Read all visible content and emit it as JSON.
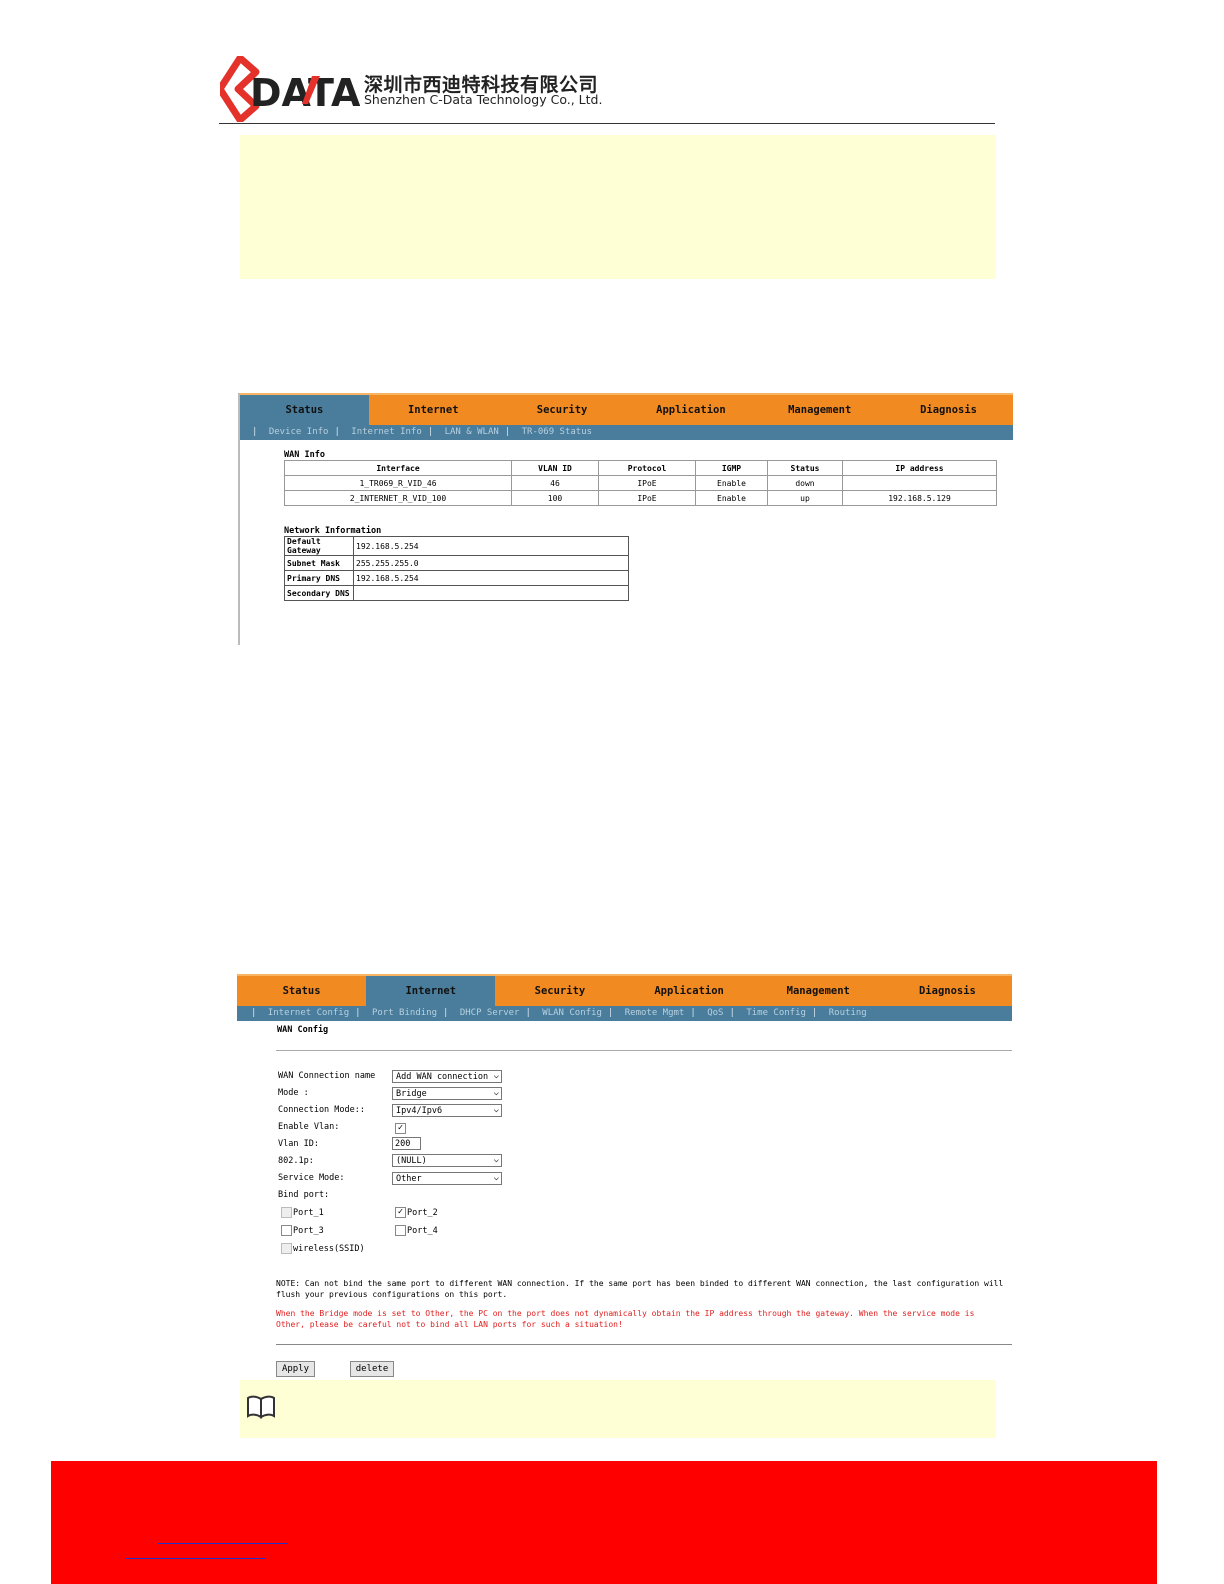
{
  "header": {
    "company_cn": "深圳市西迪特科技有限公司",
    "company_en": "Shenzhen C-Data Technology Co., Ltd.",
    "logo_text": "DATA",
    "logo_color": "#e4322b"
  },
  "screen1": {
    "tabs": [
      "Status",
      "Internet",
      "Security",
      "Application",
      "Management",
      "Diagnosis"
    ],
    "active_tab": "Status",
    "subnav": [
      "Device Info",
      "Internet Info",
      "LAN & WLAN",
      "TR-069 Status"
    ],
    "wan_title": "WAN Info",
    "wan_headers": [
      "Interface",
      "VLAN ID",
      "Protocol",
      "IGMP",
      "Status",
      "IP address"
    ],
    "wan_rows": [
      [
        "1_TR069_R_VID_46",
        "46",
        "IPoE",
        "Enable",
        "down",
        ""
      ],
      [
        "2_INTERNET_R_VID_100",
        "100",
        "IPoE",
        "Enable",
        "up",
        "192.168.5.129"
      ]
    ],
    "net_title": "Network Information",
    "net_rows": [
      [
        "Default Gateway",
        "192.168.5.254"
      ],
      [
        "Subnet Mask",
        "255.255.255.0"
      ],
      [
        "Primary DNS",
        "192.168.5.254"
      ],
      [
        "Secondary DNS",
        ""
      ]
    ]
  },
  "screen2": {
    "tabs": [
      "Status",
      "Internet",
      "Security",
      "Application",
      "Management",
      "Diagnosis"
    ],
    "active_tab": "Internet",
    "subnav": [
      "Internet Config",
      "Port Binding",
      "DHCP Server",
      "WLAN Config",
      "Remote Mgmt",
      "QoS",
      "Time Config",
      "Routing"
    ],
    "title": "WAN Config",
    "fields": {
      "wan_conn_label": "WAN Connection name",
      "wan_conn_value": "Add WAN connection",
      "mode_label": "Mode :",
      "mode_value": "Bridge",
      "conn_mode_label": "Connection Mode::",
      "conn_mode_value": "Ipv4/Ipv6",
      "enable_vlan_label": "Enable Vlan:",
      "enable_vlan_checked": true,
      "vlan_id_label": "Vlan ID:",
      "vlan_id_value": "200",
      "p8021p_label": "802.1p:",
      "p8021p_value": "(NULL)",
      "service_mode_label": "Service Mode:",
      "service_mode_value": "Other",
      "bind_port_label": "Bind port:"
    },
    "ports": [
      {
        "name": "Port_1",
        "checked": false
      },
      {
        "name": "Port_2",
        "checked": true
      },
      {
        "name": "Port_3",
        "checked": false
      },
      {
        "name": "Port_4",
        "checked": false
      }
    ],
    "wireless_label": "wireless(SSID)",
    "note": "NOTE: Can not bind the same port to different WAN connection. If the same port has been binded to different WAN connection, the last configuration will flush your previous configurations on this port.",
    "warning": "When the Bridge mode is set to Other, the PC on the port does not dynamically obtain the IP address through the gateway. When the service mode is Other, please be careful not to bind all LAN ports for such a situation!",
    "apply_label": "Apply",
    "delete_label": "delete"
  },
  "colors": {
    "tab_orange": "#f28a22",
    "tab_active_blue": "#4a7d9c",
    "note_yellow": "#ffffd6",
    "footer_red": "#ff0000",
    "warning_red": "#e02020"
  }
}
